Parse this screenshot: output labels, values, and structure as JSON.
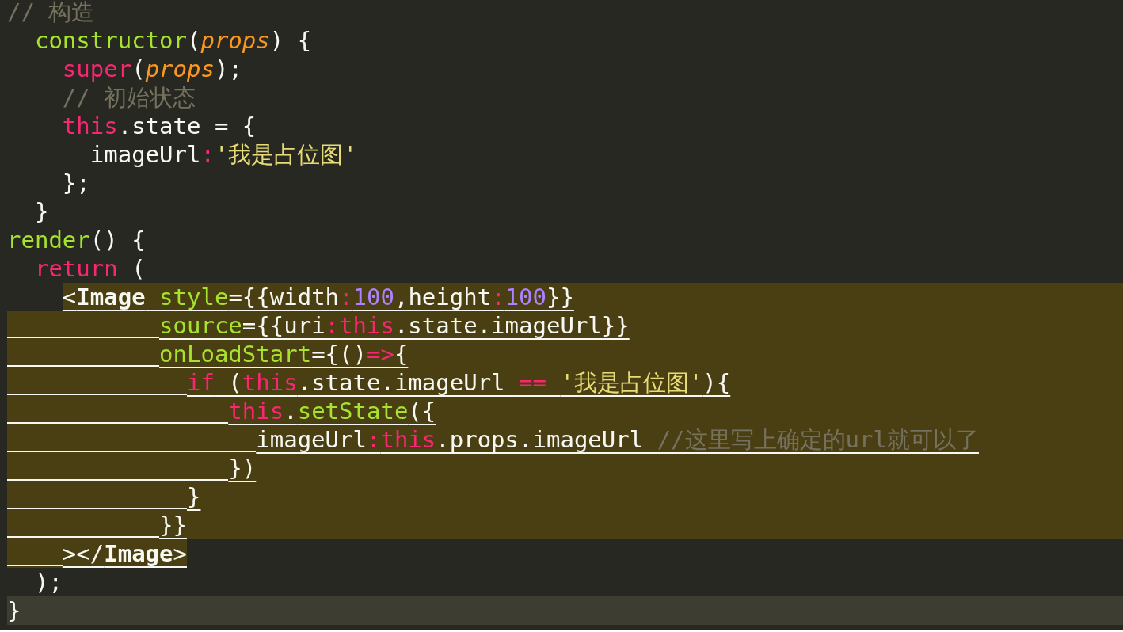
{
  "editor": {
    "lines": [
      {
        "kind": "plain",
        "tokens": [
          {
            "kind": "comment",
            "text": "// 构造"
          }
        ]
      },
      {
        "kind": "plain",
        "tokens": [
          {
            "kind": "function",
            "text": "  constructor"
          },
          {
            "kind": "plain",
            "text": "("
          },
          {
            "kind": "param",
            "text": "props"
          },
          {
            "kind": "plain",
            "text": ") {"
          }
        ]
      },
      {
        "kind": "plain",
        "tokens": [
          {
            "kind": "keyword",
            "text": "    super"
          },
          {
            "kind": "plain",
            "text": "("
          },
          {
            "kind": "param",
            "text": "props"
          },
          {
            "kind": "plain",
            "text": ");"
          }
        ]
      },
      {
        "kind": "plain",
        "tokens": [
          {
            "kind": "comment",
            "text": "    // 初始状态"
          }
        ]
      },
      {
        "kind": "plain",
        "tokens": [
          {
            "kind": "keyword",
            "text": "    this"
          },
          {
            "kind": "plain",
            "text": ".state = {"
          }
        ]
      },
      {
        "kind": "plain",
        "tokens": [
          {
            "kind": "plain",
            "text": "      imageUrl"
          },
          {
            "kind": "keyword",
            "text": ":"
          },
          {
            "kind": "string",
            "text": "'我是占位图'"
          }
        ]
      },
      {
        "kind": "plain",
        "tokens": [
          {
            "kind": "plain",
            "text": "    };"
          }
        ]
      },
      {
        "kind": "plain",
        "tokens": [
          {
            "kind": "plain",
            "text": "  }"
          }
        ]
      },
      {
        "kind": "plain",
        "tokens": [
          {
            "kind": "function",
            "text": "render"
          },
          {
            "kind": "plain",
            "text": "() {"
          }
        ]
      },
      {
        "kind": "plain",
        "tokens": [
          {
            "kind": "keyword",
            "text": "  return"
          },
          {
            "kind": "plain",
            "text": " ("
          }
        ]
      },
      {
        "kind": "selection_start",
        "tokens": [
          {
            "kind": "plain",
            "text": "    <"
          },
          {
            "kind": "tag",
            "text": "Image"
          },
          {
            "kind": "function",
            "text": " style"
          },
          {
            "kind": "plain",
            "text": "={{width"
          },
          {
            "kind": "keyword",
            "text": ":"
          },
          {
            "kind": "number",
            "text": "100"
          },
          {
            "kind": "plain",
            "text": ",height"
          },
          {
            "kind": "keyword",
            "text": ":"
          },
          {
            "kind": "number",
            "text": "100"
          },
          {
            "kind": "plain",
            "text": "}}"
          }
        ]
      },
      {
        "kind": "selected",
        "tokens": [
          {
            "kind": "function",
            "text": "           source"
          },
          {
            "kind": "plain",
            "text": "={{uri"
          },
          {
            "kind": "keyword",
            "text": ":"
          },
          {
            "kind": "keyword",
            "text": "this"
          },
          {
            "kind": "plain",
            "text": ".state.imageUrl}}"
          }
        ]
      },
      {
        "kind": "selected",
        "tokens": [
          {
            "kind": "function",
            "text": "           onLoadStart"
          },
          {
            "kind": "plain",
            "text": "={()"
          },
          {
            "kind": "keyword",
            "text": "=>"
          },
          {
            "kind": "plain",
            "text": "{"
          }
        ]
      },
      {
        "kind": "selected",
        "tokens": [
          {
            "kind": "keyword",
            "text": "             if"
          },
          {
            "kind": "plain",
            "text": " ("
          },
          {
            "kind": "keyword",
            "text": "this"
          },
          {
            "kind": "plain",
            "text": ".state.imageUrl "
          },
          {
            "kind": "keyword",
            "text": "== "
          },
          {
            "kind": "string",
            "text": "'我是占位图'"
          },
          {
            "kind": "plain",
            "text": "){"
          }
        ]
      },
      {
        "kind": "selected",
        "tokens": [
          {
            "kind": "keyword",
            "text": "                this"
          },
          {
            "kind": "plain",
            "text": "."
          },
          {
            "kind": "function",
            "text": "setState"
          },
          {
            "kind": "plain",
            "text": "({"
          }
        ]
      },
      {
        "kind": "selected",
        "tokens": [
          {
            "kind": "plain",
            "text": "                  imageUrl"
          },
          {
            "kind": "keyword",
            "text": ":"
          },
          {
            "kind": "keyword",
            "text": "this"
          },
          {
            "kind": "plain",
            "text": ".props.imageUrl "
          },
          {
            "kind": "comment",
            "text": "//这里写上确定的url就可以了"
          }
        ]
      },
      {
        "kind": "selected",
        "tokens": [
          {
            "kind": "plain",
            "text": "                })"
          }
        ]
      },
      {
        "kind": "selected",
        "tokens": [
          {
            "kind": "plain",
            "text": "             }"
          }
        ]
      },
      {
        "kind": "selected",
        "tokens": [
          {
            "kind": "plain",
            "text": "           }}"
          }
        ]
      },
      {
        "kind": "selection_end",
        "tokens": [
          {
            "kind": "plain",
            "text": "    ></"
          },
          {
            "kind": "tag",
            "text": "Image"
          },
          {
            "kind": "plain",
            "text": ">"
          }
        ]
      },
      {
        "kind": "plain",
        "tokens": [
          {
            "kind": "plain",
            "text": "  );"
          }
        ]
      },
      {
        "kind": "current",
        "tokens": [
          {
            "kind": "plain",
            "text": "}"
          }
        ]
      }
    ]
  }
}
